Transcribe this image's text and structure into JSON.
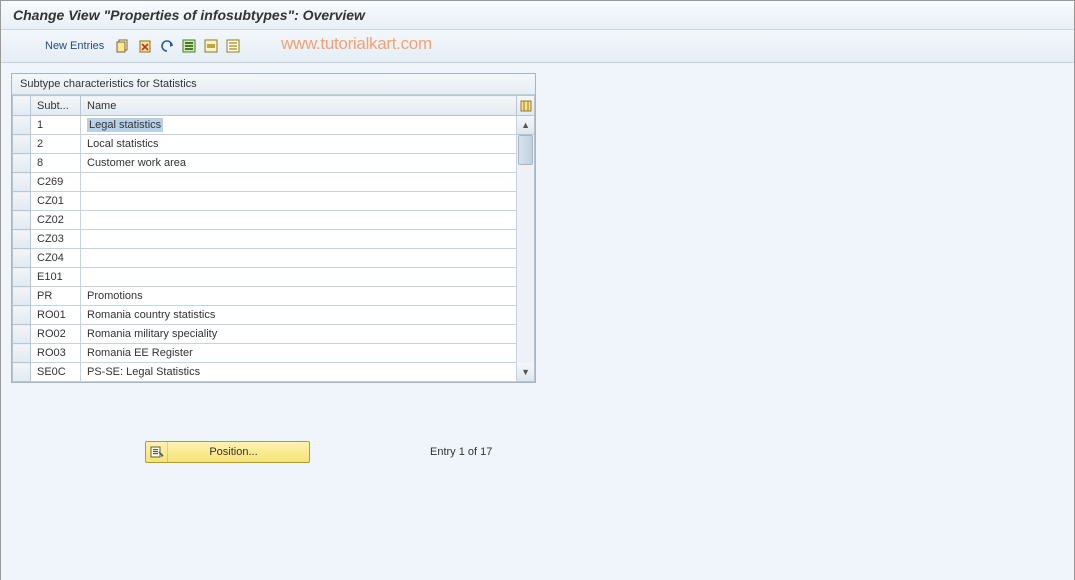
{
  "title": "Change View \"Properties of infosubtypes\": Overview",
  "toolbar": {
    "new_entries": "New Entries",
    "icons": [
      "copy-icon",
      "trash-icon",
      "undo-icon",
      "select-all-icon",
      "select-block-icon",
      "deselect-all-icon"
    ]
  },
  "watermark": "www.tutorialkart.com",
  "panel": {
    "title": "Subtype characteristics for Statistics",
    "columns": {
      "sel": "",
      "subt": "Subt...",
      "name": "Name"
    }
  },
  "rows": [
    {
      "subt": "1",
      "name": "Legal statistics",
      "selected": true
    },
    {
      "subt": "2",
      "name": "Local statistics",
      "selected": false
    },
    {
      "subt": "8",
      "name": "Customer work area",
      "selected": false
    },
    {
      "subt": "C269",
      "name": "",
      "selected": false
    },
    {
      "subt": "CZ01",
      "name": "",
      "selected": false
    },
    {
      "subt": "CZ02",
      "name": "",
      "selected": false
    },
    {
      "subt": "CZ03",
      "name": "",
      "selected": false
    },
    {
      "subt": "CZ04",
      "name": "",
      "selected": false
    },
    {
      "subt": "E101",
      "name": "",
      "selected": false
    },
    {
      "subt": "PR",
      "name": "Promotions",
      "selected": false
    },
    {
      "subt": "RO01",
      "name": "Romania country statistics",
      "selected": false
    },
    {
      "subt": "RO02",
      "name": "Romania military speciality",
      "selected": false
    },
    {
      "subt": "RO03",
      "name": "Romania EE Register",
      "selected": false
    },
    {
      "subt": "SE0C",
      "name": "PS-SE: Legal Statistics",
      "selected": false
    }
  ],
  "footer": {
    "position_label": "Position...",
    "entry_text": "Entry 1 of 17"
  }
}
